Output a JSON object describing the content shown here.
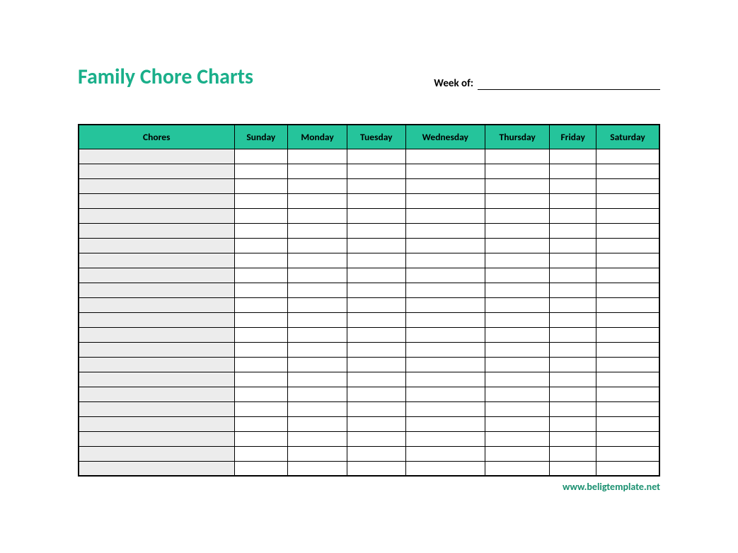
{
  "title": "Family Chore Charts",
  "week_label": "Week of:",
  "week_value": "",
  "columns": {
    "chores": "Chores",
    "days": [
      "Sunday",
      "Monday",
      "Tuesday",
      "Wednesday",
      "Thursday",
      "Friday",
      "Saturday"
    ]
  },
  "rows": [
    {
      "chore": "",
      "days": [
        "",
        "",
        "",
        "",
        "",
        "",
        ""
      ]
    },
    {
      "chore": "",
      "days": [
        "",
        "",
        "",
        "",
        "",
        "",
        ""
      ]
    },
    {
      "chore": "",
      "days": [
        "",
        "",
        "",
        "",
        "",
        "",
        ""
      ]
    },
    {
      "chore": "",
      "days": [
        "",
        "",
        "",
        "",
        "",
        "",
        ""
      ]
    },
    {
      "chore": "",
      "days": [
        "",
        "",
        "",
        "",
        "",
        "",
        ""
      ]
    },
    {
      "chore": "",
      "days": [
        "",
        "",
        "",
        "",
        "",
        "",
        ""
      ]
    },
    {
      "chore": "",
      "days": [
        "",
        "",
        "",
        "",
        "",
        "",
        ""
      ]
    },
    {
      "chore": "",
      "days": [
        "",
        "",
        "",
        "",
        "",
        "",
        ""
      ]
    },
    {
      "chore": "",
      "days": [
        "",
        "",
        "",
        "",
        "",
        "",
        ""
      ]
    },
    {
      "chore": "",
      "days": [
        "",
        "",
        "",
        "",
        "",
        "",
        ""
      ]
    },
    {
      "chore": "",
      "days": [
        "",
        "",
        "",
        "",
        "",
        "",
        ""
      ]
    },
    {
      "chore": "",
      "days": [
        "",
        "",
        "",
        "",
        "",
        "",
        ""
      ]
    },
    {
      "chore": "",
      "days": [
        "",
        "",
        "",
        "",
        "",
        "",
        ""
      ]
    },
    {
      "chore": "",
      "days": [
        "",
        "",
        "",
        "",
        "",
        "",
        ""
      ]
    },
    {
      "chore": "",
      "days": [
        "",
        "",
        "",
        "",
        "",
        "",
        ""
      ]
    },
    {
      "chore": "",
      "days": [
        "",
        "",
        "",
        "",
        "",
        "",
        ""
      ]
    },
    {
      "chore": "",
      "days": [
        "",
        "",
        "",
        "",
        "",
        "",
        ""
      ]
    },
    {
      "chore": "",
      "days": [
        "",
        "",
        "",
        "",
        "",
        "",
        ""
      ]
    },
    {
      "chore": "",
      "days": [
        "",
        "",
        "",
        "",
        "",
        "",
        ""
      ]
    },
    {
      "chore": "",
      "days": [
        "",
        "",
        "",
        "",
        "",
        "",
        ""
      ]
    },
    {
      "chore": "",
      "days": [
        "",
        "",
        "",
        "",
        "",
        "",
        ""
      ]
    },
    {
      "chore": "",
      "days": [
        "",
        "",
        "",
        "",
        "",
        "",
        ""
      ]
    }
  ],
  "footer_link": "www.beligtemplate.net"
}
